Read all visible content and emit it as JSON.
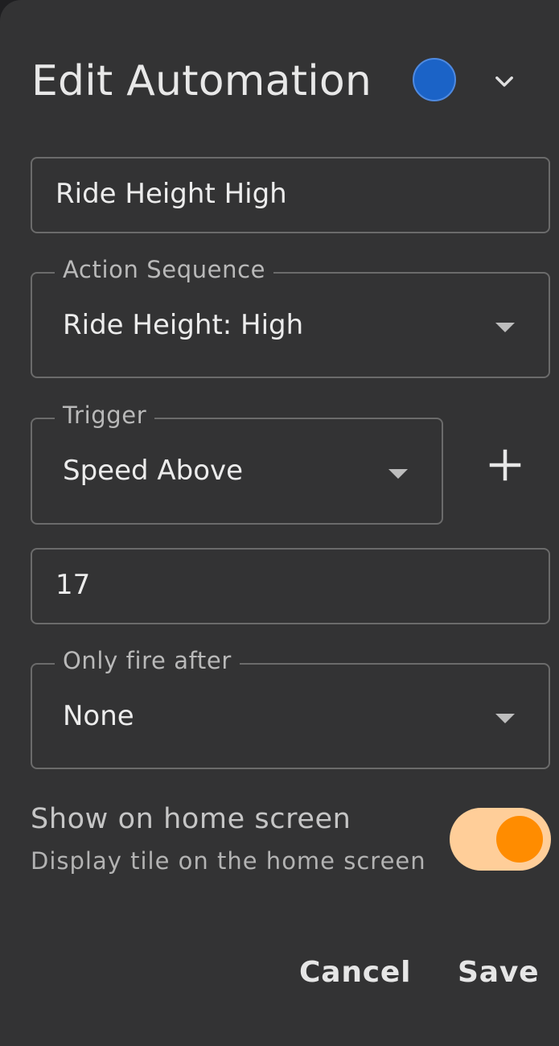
{
  "dialog": {
    "title": "Edit Automation",
    "color_swatch": {
      "color": "#1b63c7",
      "icon": "chevron-down-icon"
    }
  },
  "form": {
    "name_value": "Ride Height High",
    "action_sequence": {
      "label": "Action Sequence",
      "value": "Ride Height: High"
    },
    "trigger": {
      "label": "Trigger",
      "value": "Speed Above",
      "add_icon": "plus-icon"
    },
    "trigger_value": "17",
    "only_fire_after": {
      "label": "Only fire after",
      "value": "None"
    },
    "home_screen": {
      "title": "Show on home screen",
      "subtitle": "Display tile on the home screen",
      "enabled": true,
      "accent": "#ff8c00"
    }
  },
  "actions": {
    "cancel_label": "Cancel",
    "save_label": "Save"
  }
}
